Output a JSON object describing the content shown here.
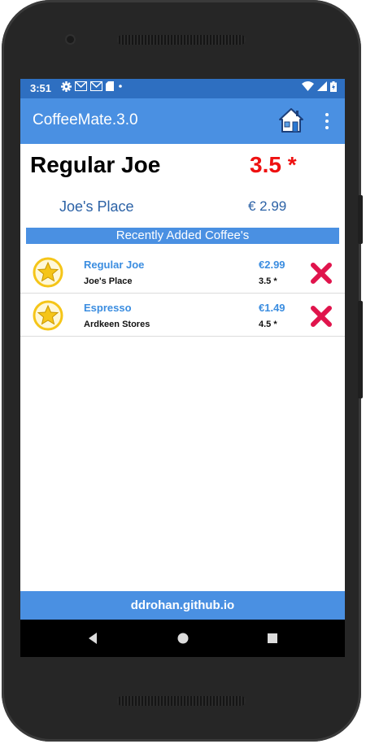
{
  "status_bar": {
    "time": "3:51"
  },
  "app_bar": {
    "title": "CoffeeMate.3.0"
  },
  "selected_coffee": {
    "name": "Regular Joe",
    "rating": "3.5 *",
    "shop": "Joe's Place",
    "price": "€ 2.99"
  },
  "section_title": "Recently Added Coffee's",
  "coffee_list": [
    {
      "name": "Regular Joe",
      "shop": "Joe's Place",
      "price": "€2.99",
      "rating": "3.5 *"
    },
    {
      "name": "Espresso",
      "shop": "Ardkeen Stores",
      "price": "€1.49",
      "rating": "4.5 *"
    }
  ],
  "footer": {
    "text": "ddrohan.github.io"
  },
  "colors": {
    "app_bar": "#4a90e2",
    "status_bar": "#2e6fc1",
    "rating_red": "#ee1111",
    "delete_red": "#e0144c",
    "star_yellow": "#f5c518"
  },
  "icons": {
    "home": "home-icon",
    "menu": "overflow-menu-icon",
    "favourite": "star-icon",
    "delete": "delete-x-icon"
  }
}
